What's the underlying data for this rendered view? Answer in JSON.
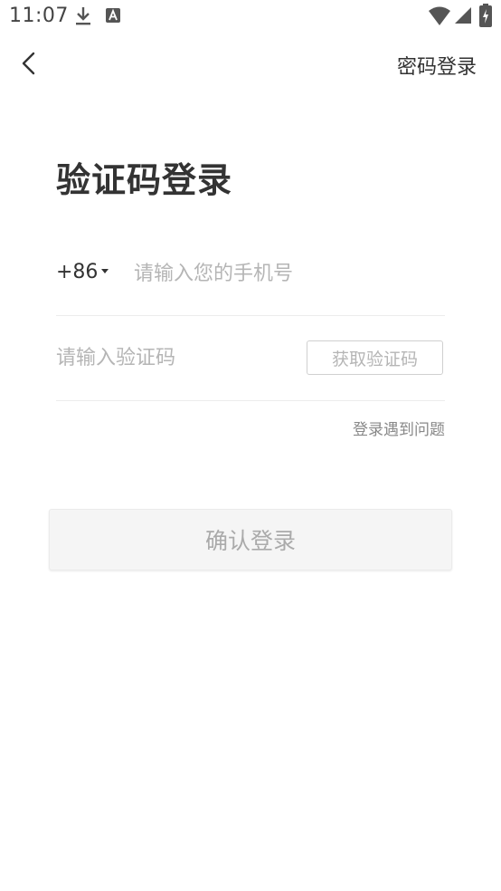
{
  "status_bar": {
    "time": "11:07",
    "icons": [
      "download-icon",
      "a-notification-icon",
      "wifi-icon",
      "signal-icon",
      "battery-icon"
    ]
  },
  "nav": {
    "back_icon": "chevron-left-icon",
    "password_login_label": "密码登录"
  },
  "title": "验证码登录",
  "phone": {
    "country_code": "+86",
    "placeholder": "请输入您的手机号",
    "value": ""
  },
  "code": {
    "placeholder": "请输入验证码",
    "value": "",
    "get_code_label": "获取验证码"
  },
  "help_label": "登录遇到问题",
  "confirm_label": "确认登录",
  "colors": {
    "text_primary": "#333333",
    "placeholder": "#b5b5b5",
    "muted": "#888888",
    "button_disabled_bg": "#f5f5f5",
    "button_disabled_text": "#aaaaaa"
  }
}
